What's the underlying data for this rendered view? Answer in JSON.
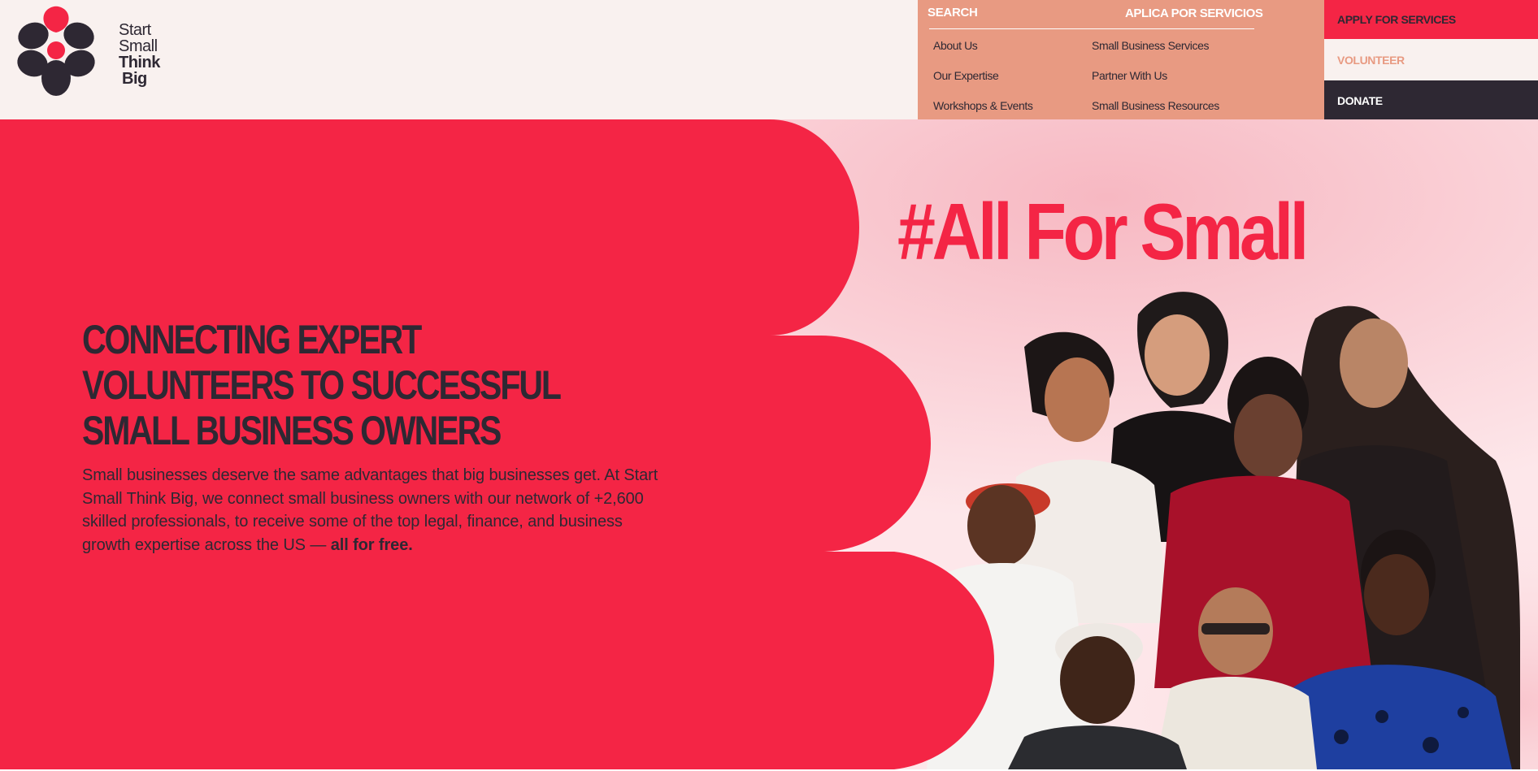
{
  "brand": {
    "logo_lines": [
      "Start",
      "Small",
      "Think",
      "Big"
    ],
    "colors": {
      "red": "#f42545",
      "dark": "#2e2833",
      "salmon": "#e89a82",
      "cream": "#f9f1ef",
      "pink_bg": "#fde7ea"
    }
  },
  "nav": {
    "search_label": "SEARCH",
    "aplica_label": "APLICA POR SERVICIOS",
    "col1": [
      "About Us",
      "Our Expertise",
      "Workshops & Events"
    ],
    "col2": [
      "Small Business Services",
      "Partner With Us",
      "Small Business Resources"
    ]
  },
  "cta": {
    "apply": "APPLY FOR SERVICES",
    "volunteer": "VOLUNTEER",
    "donate": "DONATE"
  },
  "hero": {
    "hashtag": "#All For Small",
    "headline": "CONNECTING EXPERT VOLUNTEERS TO SUCCESSFUL SMALL BUSINESS OWNERS",
    "body_main": "Small businesses deserve the same advantages that big businesses get. At Start Small Think Big, we connect small business owners with our network of +2,600 skilled professionals, to receive some of the top legal, finance, and business growth expertise across the US — ",
    "body_bold": "all for free.",
    "image_subject": "group-portrait-of-eight-small-business-owners"
  }
}
